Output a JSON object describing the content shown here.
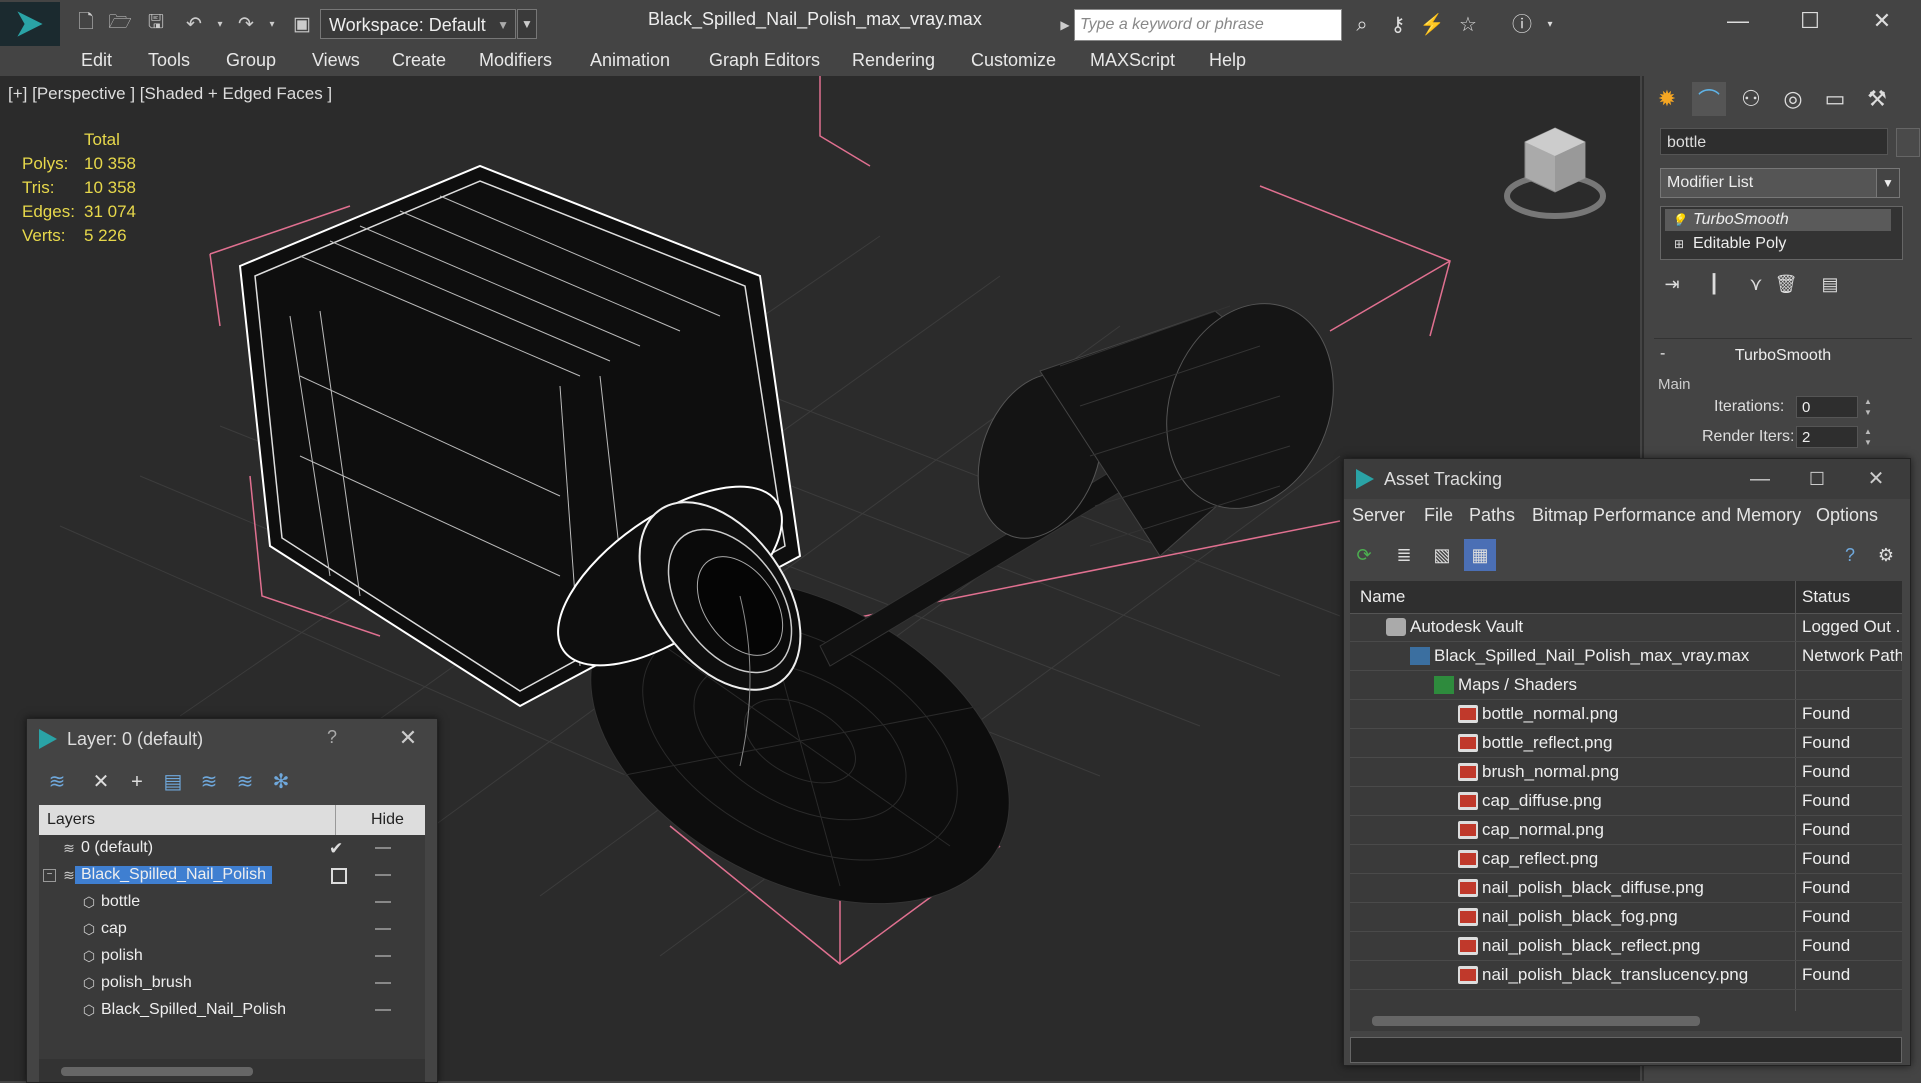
{
  "titlebar": {
    "workspace": "Workspace: Default",
    "document_title": "Black_Spilled_Nail_Polish_max_vray.max",
    "search_placeholder": "Type a keyword or phrase",
    "toolbar_icons": [
      "new-file-icon",
      "open-folder-icon",
      "save-icon",
      "undo-icon",
      "redo-icon",
      "project-folder-icon"
    ],
    "right_icons": [
      "binoculars-icon",
      "key-icon",
      "exchange-icon",
      "star-icon",
      "help-icon"
    ]
  },
  "menu": [
    "Edit",
    "Tools",
    "Group",
    "Views",
    "Create",
    "Modifiers",
    "Animation",
    "Graph Editors",
    "Rendering",
    "Customize",
    "MAXScript",
    "Help"
  ],
  "viewport": {
    "label": "[+] [Perspective ] [Shaded + Edged Faces ]",
    "stats": {
      "header": "Total",
      "rows": [
        {
          "label": "Polys:",
          "value": "10 358"
        },
        {
          "label": "Tris:",
          "value": "10 358"
        },
        {
          "label": "Edges:",
          "value": "31 074"
        },
        {
          "label": "Verts:",
          "value": "5 226"
        }
      ]
    }
  },
  "command_panel": {
    "tabs": [
      "create-tab-icon",
      "modify-tab-icon",
      "hierarchy-tab-icon",
      "motion-tab-icon",
      "display-tab-icon",
      "utilities-tab-icon"
    ],
    "object_name": "bottle",
    "modifier_list": "Modifier List",
    "stack": [
      "TurboSmooth",
      "Editable Poly"
    ],
    "turbosmooth": {
      "title": "TurboSmooth",
      "group": "Main",
      "iterations_label": "Iterations:",
      "iterations": "0",
      "render_iters_label": "Render Iters:",
      "render_iters": "2"
    }
  },
  "asset_tracking": {
    "title": "Asset Tracking",
    "menu": [
      "Server",
      "File",
      "Paths",
      "Bitmap Performance and Memory",
      "Options"
    ],
    "columns": {
      "name": "Name",
      "status": "Status"
    },
    "rows": [
      {
        "name": "Autodesk Vault",
        "status": "Logged Out .",
        "icon": "vault-icon"
      },
      {
        "name": "Black_Spilled_Nail_Polish_max_vray.max",
        "status": "Network Path",
        "icon": "max-file-icon"
      },
      {
        "name": "Maps / Shaders",
        "status": "",
        "icon": "folder-icon"
      },
      {
        "name": "bottle_normal.png",
        "status": "Found",
        "icon": "png-icon"
      },
      {
        "name": "bottle_reflect.png",
        "status": "Found",
        "icon": "png-icon"
      },
      {
        "name": "brush_normal.png",
        "status": "Found",
        "icon": "png-icon"
      },
      {
        "name": "cap_diffuse.png",
        "status": "Found",
        "icon": "png-icon"
      },
      {
        "name": "cap_normal.png",
        "status": "Found",
        "icon": "png-icon"
      },
      {
        "name": "cap_reflect.png",
        "status": "Found",
        "icon": "png-icon"
      },
      {
        "name": "nail_polish_black_diffuse.png",
        "status": "Found",
        "icon": "png-icon"
      },
      {
        "name": "nail_polish_black_fog.png",
        "status": "Found",
        "icon": "png-icon"
      },
      {
        "name": "nail_polish_black_reflect.png",
        "status": "Found",
        "icon": "png-icon"
      },
      {
        "name": "nail_polish_black_translucency.png",
        "status": "Found",
        "icon": "png-icon"
      }
    ]
  },
  "layer_explorer": {
    "title": "Layer: 0 (default)",
    "help": "?",
    "columns": {
      "layers": "Layers",
      "hide": "Hide"
    },
    "rows": [
      {
        "name": "0 (default)"
      },
      {
        "name": "Black_Spilled_Nail_Polish"
      },
      {
        "name": "bottle"
      },
      {
        "name": "cap"
      },
      {
        "name": "polish"
      },
      {
        "name": "polish_brush"
      },
      {
        "name": "Black_Spilled_Nail_Polish"
      }
    ]
  }
}
